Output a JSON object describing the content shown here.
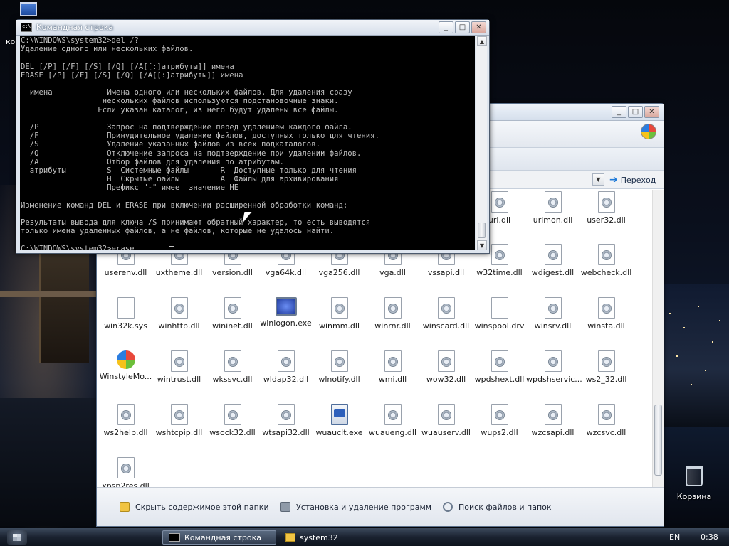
{
  "desktop": {
    "computer_label": "ко",
    "recycle_bin_label": "Корзина"
  },
  "cmd": {
    "title": "Командная строка",
    "output_lines": [
      "C:\\WINDOWS\\system32>del /?",
      "Удаление одного или нескольких файлов.",
      "",
      "DEL [/P] [/F] [/S] [/Q] [/A[[:]атрибуты]] имена",
      "ERASE [/P] [/F] [/S] [/Q] [/A[[:]атрибуты]] имена",
      "",
      "  имена            Имена одного или нескольких файлов. Для удаления сразу",
      "                  нескольких файлов используются подстановочные знаки.",
      "                 Если указан каталог, из него будут удалены все файлы.",
      "",
      "  /P               Запрос на подтверждение перед удалением каждого файла.",
      "  /F               Принудительное удаление файлов, доступных только для чтения.",
      "  /S               Удаление указанных файлов из всех подкаталогов.",
      "  /Q               Отключение запроса на подтверждение при удалении файлов.",
      "  /A               Отбор файлов для удаления по атрибутам.",
      "  атрибуты         S  Системные файлы       R  Доступные только для чтения",
      "                   H  Скрытые файлы         A  Файлы для архивирования",
      "                   Префикс \"-\" имеет значение НЕ",
      "",
      "Изменение команд DEL и ERASE при включении расширенной обработки команд:",
      "",
      "Результаты вывода для ключа /S принимают обратный характер, то есть выводятся",
      "только имена удаленных файлов, а не файлов, которые не удалось найти.",
      "",
      "C:\\WINDOWS\\system32>erase "
    ]
  },
  "explorer": {
    "go_label": "Переход",
    "rows": [
      [
        {
          "name": "",
          "type": "hidden"
        },
        {
          "name": "",
          "type": "hidden"
        },
        {
          "name": "",
          "type": "hidden"
        },
        {
          "name": "",
          "type": "hidden"
        },
        {
          "name": "",
          "type": "hidden"
        },
        {
          "name": "",
          "type": "hidden"
        },
        {
          "name": "",
          "type": "hidden"
        },
        {
          "name": "url.dll",
          "type": "dll"
        },
        {
          "name": "urlmon.dll",
          "type": "dll"
        },
        {
          "name": "user32.dll",
          "type": "dll"
        }
      ],
      [
        {
          "name": "userenv.dll",
          "type": "dll"
        },
        {
          "name": "uxtheme.dll",
          "type": "dll"
        },
        {
          "name": "version.dll",
          "type": "dll"
        },
        {
          "name": "vga64k.dll",
          "type": "dll"
        },
        {
          "name": "vga256.dll",
          "type": "dll"
        },
        {
          "name": "vga.dll",
          "type": "dll"
        },
        {
          "name": "vssapi.dll",
          "type": "dll"
        },
        {
          "name": "w32time.dll",
          "type": "dll"
        },
        {
          "name": "wdigest.dll",
          "type": "dll"
        },
        {
          "name": "webcheck.dll",
          "type": "dll"
        }
      ],
      [
        {
          "name": "win32k.sys",
          "type": "plain"
        },
        {
          "name": "winhttp.dll",
          "type": "dll"
        },
        {
          "name": "wininet.dll",
          "type": "dll"
        },
        {
          "name": "winlogon.exe",
          "type": "mon"
        },
        {
          "name": "winmm.dll",
          "type": "dll"
        },
        {
          "name": "winrnr.dll",
          "type": "dll"
        },
        {
          "name": "winscard.dll",
          "type": "dll"
        },
        {
          "name": "winspool.drv",
          "type": "plain"
        },
        {
          "name": "winsrv.dll",
          "type": "dll"
        },
        {
          "name": "winsta.dll",
          "type": "dll"
        }
      ],
      [
        {
          "name": "WinstyleMo...",
          "type": "winlogo"
        },
        {
          "name": "wintrust.dll",
          "type": "dll"
        },
        {
          "name": "wkssvc.dll",
          "type": "dll"
        },
        {
          "name": "wldap32.dll",
          "type": "dll"
        },
        {
          "name": "wlnotify.dll",
          "type": "dll"
        },
        {
          "name": "wmi.dll",
          "type": "dll"
        },
        {
          "name": "wow32.dll",
          "type": "dll"
        },
        {
          "name": "wpdshext.dll",
          "type": "dll"
        },
        {
          "name": "wpdshservic...",
          "type": "dll"
        },
        {
          "name": "ws2_32.dll",
          "type": "dll"
        }
      ],
      [
        {
          "name": "ws2help.dll",
          "type": "dll"
        },
        {
          "name": "wshtcpip.dll",
          "type": "dll"
        },
        {
          "name": "wsock32.dll",
          "type": "dll"
        },
        {
          "name": "wtsapi32.dll",
          "type": "dll"
        },
        {
          "name": "wuauclt.exe",
          "type": "exe"
        },
        {
          "name": "wuaueng.dll",
          "type": "dll"
        },
        {
          "name": "wuauserv.dll",
          "type": "dll"
        },
        {
          "name": "wups2.dll",
          "type": "dll"
        },
        {
          "name": "wzcsapi.dll",
          "type": "dll"
        },
        {
          "name": "wzcsvc.dll",
          "type": "dll"
        }
      ],
      [
        {
          "name": "xpsp2res.dll",
          "type": "dll"
        }
      ]
    ],
    "tasks": {
      "hide": "Скрыть содержимое этой папки",
      "install": "Установка и удаление программ",
      "search": "Поиск файлов и папок"
    }
  },
  "taskbar": {
    "cmd_label": "Командная строка",
    "explorer_label": "system32",
    "language": "EN",
    "clock": "0:38"
  }
}
